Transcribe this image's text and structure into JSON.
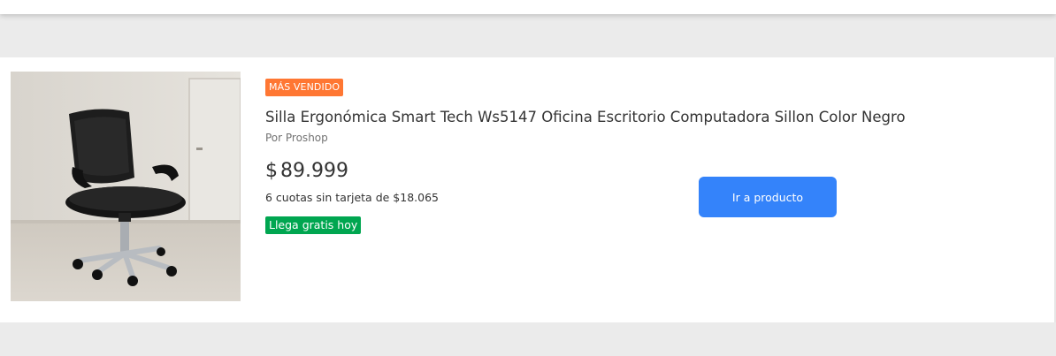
{
  "product": {
    "badge": "MÁS VENDIDO",
    "title": "Silla Ergonómica Smart Tech Ws5147 Oficina Escritorio Computadora Sillon Color Negro",
    "seller": "Por Proshop",
    "price": {
      "currency": "$",
      "amount": "89.999"
    },
    "installments": "6 cuotas sin tarjeta de $18.065",
    "shipping_badge": "Llega gratis hoy",
    "cta_label": "Ir a producto",
    "image_icon": "office-chair-photo"
  },
  "colors": {
    "badge_orange": "#ff7733",
    "shipping_green": "#00a650",
    "button_blue": "#3483fa",
    "page_bg": "#ebebeb"
  }
}
